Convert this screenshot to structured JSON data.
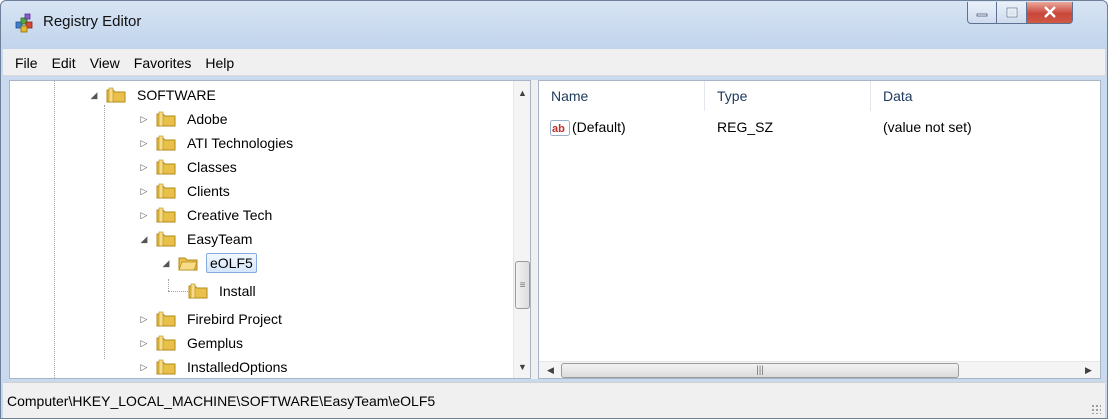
{
  "window": {
    "title": "Registry Editor",
    "icon": "registry-editor-icon",
    "controls": [
      "minimize-icon",
      "maximize-icon",
      "close-icon"
    ]
  },
  "menu": {
    "items": [
      "File",
      "Edit",
      "View",
      "Favorites",
      "Help"
    ]
  },
  "tree": {
    "items": [
      {
        "label": "SOFTWARE",
        "state": "expanded",
        "level": 0
      },
      {
        "label": "Adobe",
        "state": "collapsed",
        "level": 1
      },
      {
        "label": "ATI Technologies",
        "state": "collapsed",
        "level": 1
      },
      {
        "label": "Classes",
        "state": "collapsed",
        "level": 1
      },
      {
        "label": "Clients",
        "state": "collapsed",
        "level": 1
      },
      {
        "label": "Creative Tech",
        "state": "collapsed",
        "level": 1
      },
      {
        "label": "EasyTeam",
        "state": "expanded",
        "level": 1
      },
      {
        "label": "eOLF5",
        "state": "expanded",
        "level": 2,
        "selected": true
      },
      {
        "label": "Install",
        "state": "leaf",
        "level": 3
      },
      {
        "label": "Firebird Project",
        "state": "collapsed",
        "level": 1
      },
      {
        "label": "Gemplus",
        "state": "collapsed",
        "level": 1
      },
      {
        "label": "InstalledOptions",
        "state": "collapsed",
        "level": 1
      }
    ]
  },
  "values": {
    "columns": [
      "Name",
      "Type",
      "Data"
    ],
    "rows": [
      {
        "name": "(Default)",
        "type": "REG_SZ",
        "data": "(value not set)",
        "icon": "string-value-icon"
      }
    ]
  },
  "status": {
    "path": "Computer\\HKEY_LOCAL_MACHINE\\SOFTWARE\\EasyTeam\\eOLF5"
  },
  "colors": {
    "folder": "#e8c04a",
    "selection_border": "#84acdd",
    "header_text": "#1e395b"
  }
}
